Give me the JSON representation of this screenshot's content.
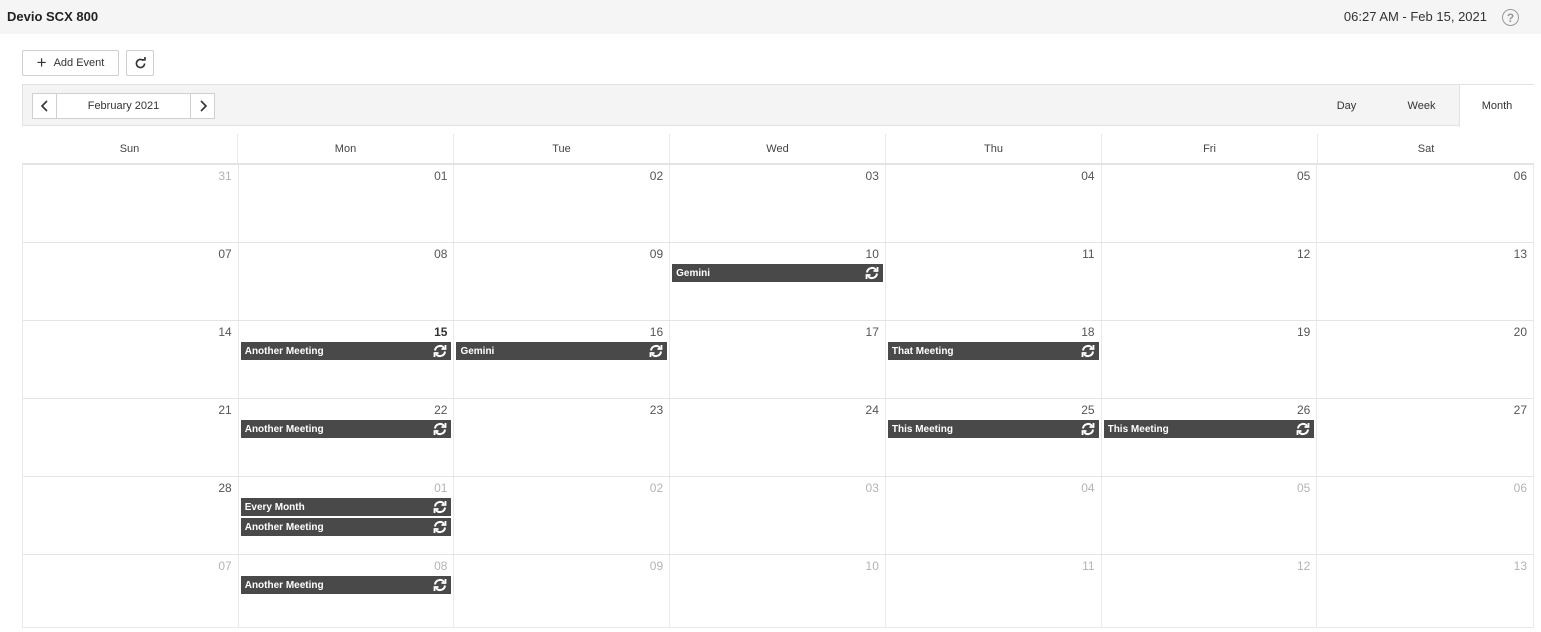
{
  "app": {
    "title": "Devio SCX 800",
    "clock": "06:27 AM - Feb 15, 2021",
    "help_glyph": "?"
  },
  "toolbar": {
    "add_event_label": "Add Event",
    "month_label": "February 2021",
    "views": [
      "Day",
      "Week",
      "Month"
    ],
    "active_view": "Month"
  },
  "calendar": {
    "day_names": [
      "Sun",
      "Mon",
      "Tue",
      "Wed",
      "Thu",
      "Fri",
      "Sat"
    ],
    "weeks": [
      [
        {
          "day": "31",
          "other": true,
          "events": []
        },
        {
          "day": "01",
          "events": []
        },
        {
          "day": "02",
          "events": []
        },
        {
          "day": "03",
          "events": []
        },
        {
          "day": "04",
          "events": []
        },
        {
          "day": "05",
          "events": []
        },
        {
          "day": "06",
          "events": []
        }
      ],
      [
        {
          "day": "07",
          "events": []
        },
        {
          "day": "08",
          "events": []
        },
        {
          "day": "09",
          "events": []
        },
        {
          "day": "10",
          "events": [
            "Gemini"
          ]
        },
        {
          "day": "11",
          "events": []
        },
        {
          "day": "12",
          "events": []
        },
        {
          "day": "13",
          "events": []
        }
      ],
      [
        {
          "day": "14",
          "events": []
        },
        {
          "day": "15",
          "today": true,
          "events": [
            "Another Meeting"
          ]
        },
        {
          "day": "16",
          "events": [
            "Gemini"
          ]
        },
        {
          "day": "17",
          "events": []
        },
        {
          "day": "18",
          "events": [
            "That Meeting"
          ]
        },
        {
          "day": "19",
          "events": []
        },
        {
          "day": "20",
          "events": []
        }
      ],
      [
        {
          "day": "21",
          "events": []
        },
        {
          "day": "22",
          "events": [
            "Another Meeting"
          ]
        },
        {
          "day": "23",
          "events": []
        },
        {
          "day": "24",
          "events": []
        },
        {
          "day": "25",
          "events": [
            "This Meeting"
          ]
        },
        {
          "day": "26",
          "events": [
            "This Meeting"
          ]
        },
        {
          "day": "27",
          "events": []
        }
      ],
      [
        {
          "day": "28",
          "events": []
        },
        {
          "day": "01",
          "other": true,
          "events": [
            "Every Month",
            "Another Meeting"
          ]
        },
        {
          "day": "02",
          "other": true,
          "events": []
        },
        {
          "day": "03",
          "other": true,
          "events": []
        },
        {
          "day": "04",
          "other": true,
          "events": []
        },
        {
          "day": "05",
          "other": true,
          "events": []
        },
        {
          "day": "06",
          "other": true,
          "events": []
        }
      ],
      [
        {
          "day": "07",
          "other": true,
          "events": []
        },
        {
          "day": "08",
          "other": true,
          "events": [
            "Another Meeting"
          ]
        },
        {
          "day": "09",
          "other": true,
          "events": []
        },
        {
          "day": "10",
          "other": true,
          "events": []
        },
        {
          "day": "11",
          "other": true,
          "events": []
        },
        {
          "day": "12",
          "other": true,
          "events": []
        },
        {
          "day": "13",
          "other": true,
          "events": []
        }
      ]
    ]
  },
  "icons": {
    "add": "plus-icon",
    "refresh": "refresh-icon",
    "prev": "chevron-left-icon",
    "next": "chevron-right-icon",
    "help": "help-icon",
    "recurring": "recurring-icon"
  },
  "colors": {
    "event_bg": "#494949",
    "toolbar_bg": "#f4f4f4",
    "topbar_bg": "#f5f5f5"
  }
}
